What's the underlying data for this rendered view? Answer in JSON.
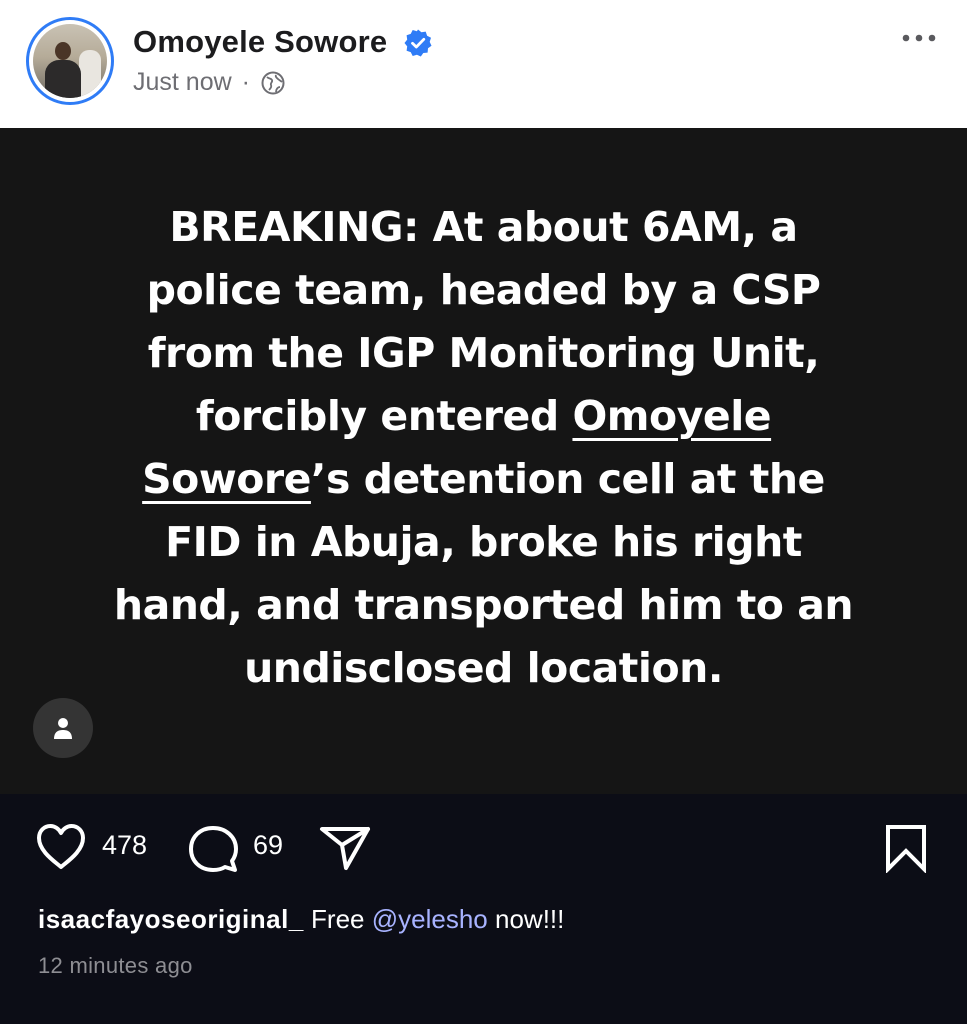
{
  "header": {
    "user_name": "Omoyele Sowore",
    "time": "Just now",
    "separator": "·"
  },
  "post": {
    "lines": [
      {
        "before": "BREAKING: At about 6AM, a",
        "mention": "",
        "after": ""
      },
      {
        "before": "police team, headed by a CSP",
        "mention": "",
        "after": ""
      },
      {
        "before": "from the IGP Monitoring Unit,",
        "mention": "",
        "after": ""
      },
      {
        "before": "forcibly entered ",
        "mention": "Omoyele",
        "after": ""
      },
      {
        "before": "",
        "mention": "Sowore",
        "after": "’s detention cell at the"
      },
      {
        "before": "FID in Abuja, broke his right",
        "mention": "",
        "after": ""
      },
      {
        "before": "hand, and transported him to an",
        "mention": "",
        "after": ""
      },
      {
        "before": "undisclosed location.",
        "mention": "",
        "after": ""
      }
    ]
  },
  "actions": {
    "likes": "478",
    "comments": "69"
  },
  "caption": {
    "username": "isaacfayoseoriginal_",
    "text_before": "Free",
    "mention": "@yelesho",
    "text_after": "now!!!"
  },
  "timestamp": "12 minutes ago",
  "colors": {
    "accent": "#2f7cf6",
    "mention_link": "#a8b3ff",
    "background_dark": "#0c0d16",
    "image_background": "#151515"
  },
  "icons": [
    "verified-badge-icon",
    "globe-icon",
    "more-options-icon",
    "user-tag-icon",
    "heart-icon",
    "comment-icon",
    "share-icon",
    "bookmark-icon"
  ]
}
